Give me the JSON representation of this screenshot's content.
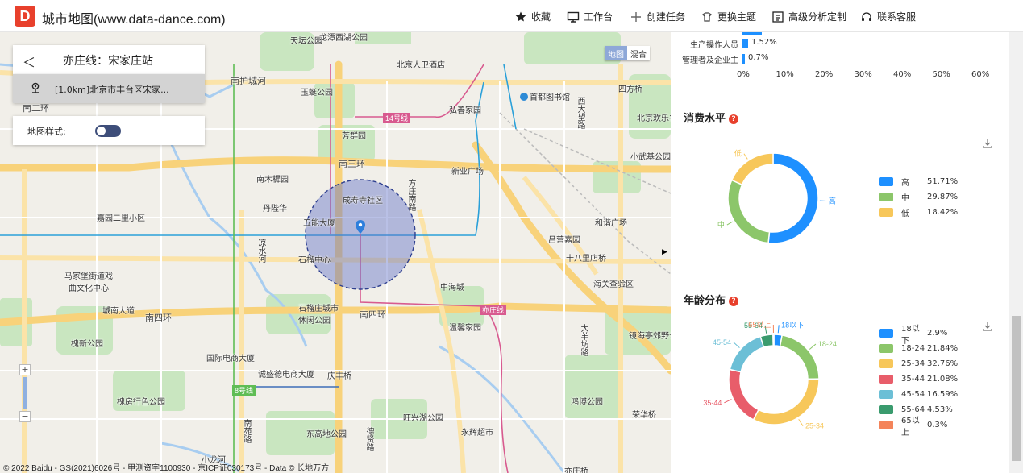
{
  "header": {
    "logo_letter": "D",
    "app_title": "城市地图(www.data-dance.com)",
    "nav": [
      {
        "label": "收藏",
        "icon": "star-icon"
      },
      {
        "label": "工作台",
        "icon": "monitor-icon"
      },
      {
        "label": "创建任务",
        "icon": "plus-icon"
      },
      {
        "label": "更换主题",
        "icon": "theme-icon"
      },
      {
        "label": "高级分析定制",
        "icon": "analysis-icon"
      },
      {
        "label": "联系客服",
        "icon": "headset-icon"
      }
    ]
  },
  "map": {
    "route_title": "亦庄线：宋家庄站",
    "back_symbol": "＜",
    "address": "[1.0km]北京市丰台区宋家...",
    "style_label": "地图样式:",
    "map_type": [
      "地图",
      "混合"
    ],
    "credit": "© 2022 Baidu - GS(2021)6026号 - 甲测资字1100930 - 京ICP证030173号 - Data © 长地万方",
    "roads": [
      "南三环",
      "南四环",
      "南二环",
      "亦庄线",
      "14号线",
      "8号线"
    ],
    "places": [
      "天坛公园",
      "龙潭西湖公园",
      "北京人卫酒店",
      "首都图书馆",
      "玉蜓公园",
      "南护城河",
      "弘善家园",
      "西大望路",
      "北京欢乐谷",
      "芳群园",
      "南木樨园",
      "新业广场",
      "成寿寺社区",
      "丹陛华",
      "五能大厦",
      "嘉园二里小区",
      "石榴中心",
      "马家堡街道戏曲文化中心",
      "中海城",
      "吕营嘉园",
      "十八里店桥",
      "海关查验区",
      "和谐广场",
      "小武基公园",
      "城南大道",
      "石榴庄城市休闲公园",
      "温馨家园",
      "槐新公园",
      "国际电商大厦",
      "诚盛德电商大厦",
      "庆丰桥",
      "槐房行色公园",
      "东高地公园",
      "旺兴湖公园",
      "永辉超市",
      "鸿博公园",
      "荣华桥",
      "四方桥",
      "南苑路",
      "德贤路",
      "小龙河",
      "镜海亭郊野公园",
      "亦庄桥",
      "大羊坊路",
      "方庄南路",
      "凉水河",
      "南三环"
    ]
  },
  "side": {
    "occupation_rows": [
      {
        "label": "生产操作人员",
        "value": 1.52,
        "value_label": "1.52%"
      },
      {
        "label": "管理者及企业主",
        "value": 0.7,
        "value_label": "0.7%"
      }
    ],
    "occupation_ticks": [
      "0%",
      "10%",
      "20%",
      "30%",
      "40%",
      "50%",
      "60%"
    ],
    "consumption_title": "消费水平",
    "age_title": "年龄分布",
    "help_symbol": "?",
    "colors": {
      "accent": "#e8402c",
      "bar": "#1e90ff"
    }
  },
  "chart_data": [
    {
      "type": "pie",
      "title": "消费水平",
      "labels": [
        "高",
        "中",
        "低"
      ],
      "values": [
        51.71,
        29.87,
        18.42
      ],
      "value_labels": [
        "51.71%",
        "29.87%",
        "18.42%"
      ],
      "colors": [
        "#1e90ff",
        "#8cc66a",
        "#f7c75a"
      ],
      "legend": "right"
    },
    {
      "type": "pie",
      "title": "年龄分布",
      "labels": [
        "18以下",
        "18-24",
        "25-34",
        "35-44",
        "45-54",
        "55-64",
        "65以上"
      ],
      "values": [
        2.9,
        21.84,
        32.76,
        21.08,
        16.59,
        4.53,
        0.3
      ],
      "value_labels": [
        "2.9%",
        "21.84%",
        "32.76%",
        "21.08%",
        "16.59%",
        "4.53%",
        "0.3%"
      ],
      "colors": [
        "#1e90ff",
        "#8cc66a",
        "#f7c75a",
        "#e85d6a",
        "#6cbfd6",
        "#3a9b6e",
        "#f4845a"
      ],
      "legend": "right"
    }
  ]
}
